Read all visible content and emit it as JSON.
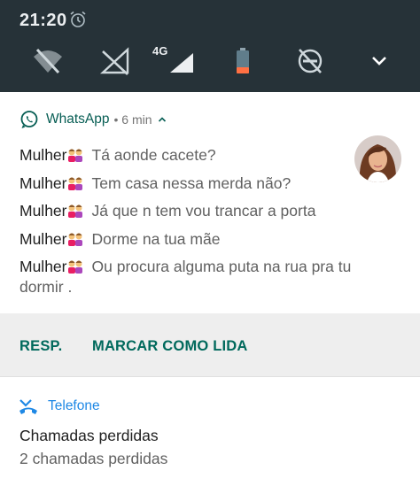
{
  "status_bar": {
    "time": "21:20",
    "network_type": "4G"
  },
  "quick_settings_icons": [
    "wifi-off-icon",
    "mobile-data-off-icon",
    "signal-4g-icon",
    "battery-low-icon",
    "do-not-disturb-icon",
    "expand-chevron-icon"
  ],
  "whatsapp": {
    "app_name": "WhatsApp",
    "time_ago": "• 6 min",
    "messages": [
      {
        "sender": "Mulher",
        "text": "Tá aonde cacete?"
      },
      {
        "sender": "Mulher",
        "text": "Tem casa nessa merda não?"
      },
      {
        "sender": "Mulher",
        "text": "Já que n tem vou trancar a porta"
      },
      {
        "sender": "Mulher",
        "text": "Dorme na tua mãe"
      },
      {
        "sender": "Mulher",
        "text": "Ou procura alguma puta na rua pra tu dormir ."
      }
    ],
    "actions": {
      "reply": "RESP.",
      "mark_read": "MARCAR COMO LIDA"
    }
  },
  "phone": {
    "app_name": "Telefone",
    "title": "Chamadas perdidas",
    "text": "2 chamadas perdidas"
  },
  "colors": {
    "quick_settings_bg": "#263238",
    "whatsapp_green": "#075e54",
    "action_teal": "#00695c",
    "phone_blue": "#1e88e5",
    "battery_orange": "#ff7043"
  }
}
